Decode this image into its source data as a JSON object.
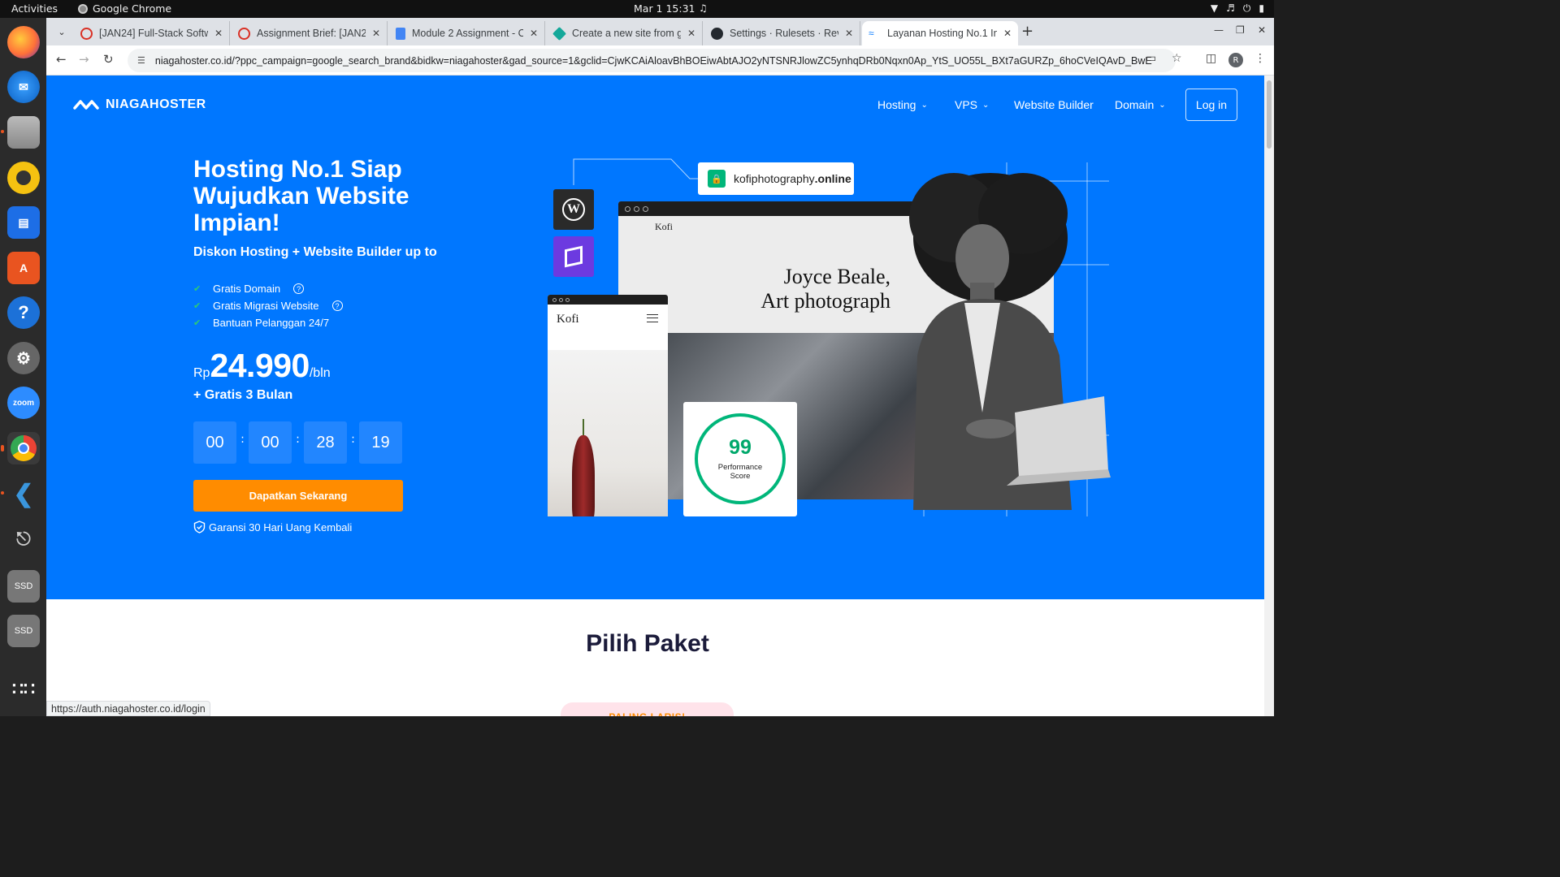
{
  "system": {
    "activities": "Activities",
    "app_name": "Google Chrome",
    "clock": "Mar 1  15:31"
  },
  "dock": {
    "items": [
      "firefox",
      "thunderbird",
      "files",
      "rhythmbox",
      "writer",
      "app-center",
      "help",
      "settings",
      "zoom",
      "chrome",
      "vscode",
      "usb-drive",
      "ssd",
      "ssd",
      "apps-grid"
    ],
    "zoom_label": "zoom",
    "ssd_label": "SSD"
  },
  "tabs": [
    {
      "title": "[JAN24] Full-Stack Softw",
      "icon": "loading-icon"
    },
    {
      "title": "Assignment Brief: [JAN2",
      "icon": "loading-icon"
    },
    {
      "title": "Module 2 Assignment - C",
      "icon": "docs-icon"
    },
    {
      "title": "Create a new site from g",
      "icon": "netlify-icon"
    },
    {
      "title": "Settings · Rulesets · Revo",
      "icon": "github-icon"
    },
    {
      "title": "Layanan Hosting No.1 In",
      "icon": "niagahoster-icon",
      "active": true
    }
  ],
  "toolbar": {
    "url": "niagahoster.co.id/?ppc_campaign=google_search_brand&bidkw=niagahoster&gad_source=1&gclid=CjwKCAiAloavBhBOEiwAbtAJO2yNTSNRJlowZC5ynhqDRb0Nqxn0Ap_YtS_UO55L_BXt7aGURZp_6hoCVeIQAvD_BwE",
    "profile_initial": "R"
  },
  "site": {
    "logo": "NIAGAHOSTER",
    "nav": {
      "hosting": "Hosting",
      "vps": "VPS",
      "website_builder": "Website Builder",
      "domain": "Domain",
      "login": "Log in"
    },
    "hero": {
      "title": "Hosting No.1 Siap Wujudkan Website Impian!",
      "subtitle": "Diskon Hosting + Website Builder up to",
      "features": [
        "Gratis Domain",
        "Gratis Migrasi Website",
        "Bantuan Pelanggan 24/7"
      ],
      "price_currency": "Rp",
      "price_amount": "24.990",
      "price_period": "/bln",
      "bonus": "+ Gratis 3 Bulan",
      "countdown": [
        "00",
        "00",
        "28",
        "19"
      ],
      "cta": "Dapatkan Sekarang",
      "guarantee": "Garansi 30 Hari Uang Kembali"
    },
    "illustration": {
      "domain_tld_name": "kofiphotography",
      "domain_tld": ".online",
      "desktop_brand": "Kofi",
      "desktop_headline_1": "Joyce Beale,",
      "desktop_headline_2": "Art photograph",
      "mobile_brand": "Kofi",
      "score": "99",
      "score_label_1": "Performance",
      "score_label_2": "Score"
    },
    "section_title": "Pilih Paket",
    "badge": "PALING LARIS!"
  },
  "status_url": "https://auth.niagahoster.co.id/login",
  "colors": {
    "brand_blue": "#0077ff",
    "cta_orange": "#ff8c00",
    "success_green": "#00b67a"
  }
}
